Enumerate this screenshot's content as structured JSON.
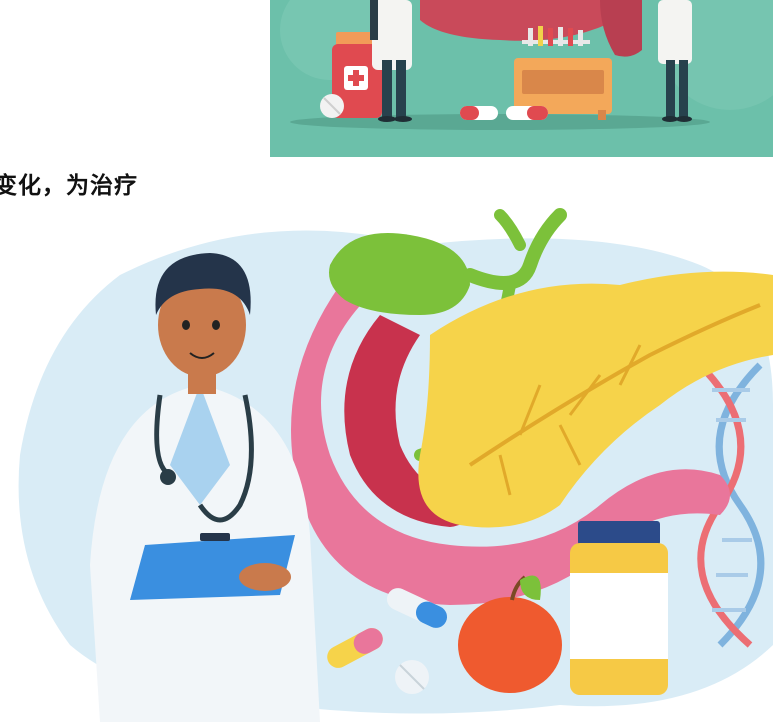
{
  "heading": {
    "text": "变化，为治疗"
  },
  "colors": {
    "teal_bg": "#6cc0aa",
    "blob_bg": "#d9ecf6",
    "pancreas": "#f6d34a",
    "intestine": "#e9769b",
    "gallbladder": "#7cc13a",
    "clipboard": "#3a8fe0",
    "dna": "#7fb3de"
  },
  "icons": {
    "top": [
      "pill-bottle-icon",
      "test-tubes-icon",
      "capsule-icon",
      "pill-icon"
    ],
    "main": [
      "doctor-figure",
      "stethoscope-icon",
      "clipboard-icon",
      "pancreas-organ",
      "gallbladder-organ",
      "intestine-organ",
      "dna-helix-icon",
      "vitamin-bottle-icon",
      "apple-icon",
      "capsule-icon",
      "tablet-icon"
    ]
  }
}
